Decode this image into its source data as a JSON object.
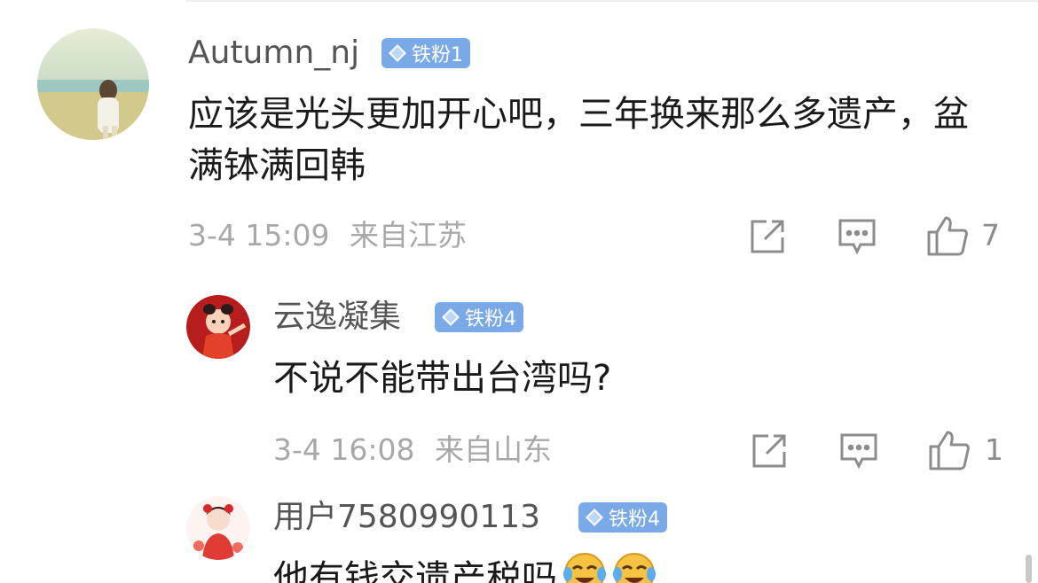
{
  "comments": [
    {
      "user": "Autumn_nj",
      "badge": "铁粉1",
      "text": "应该是光头更加开心吧，三年换来那么多遗产，盆满钵满回韩",
      "time": "3-4 15:09",
      "location": "来自江苏",
      "likes": "7"
    },
    {
      "user": "云逸凝集",
      "badge": "铁粉4",
      "text": "不说不能带出台湾吗?",
      "time": "3-4 16:08",
      "location": "来自山东",
      "likes": "1"
    },
    {
      "user": "用户7580990113",
      "badge": "铁粉4",
      "text": "他有钱交遗产税吗"
    }
  ],
  "icons": {
    "share": "share-icon",
    "reply": "comment-icon",
    "like": "thumbs-up-icon",
    "gem": "diamond-icon",
    "emoji": "crying-laughing-emoji"
  },
  "colors": {
    "badge": "#7aa9e8",
    "name": "#555555",
    "meta": "#a8a8a8"
  }
}
